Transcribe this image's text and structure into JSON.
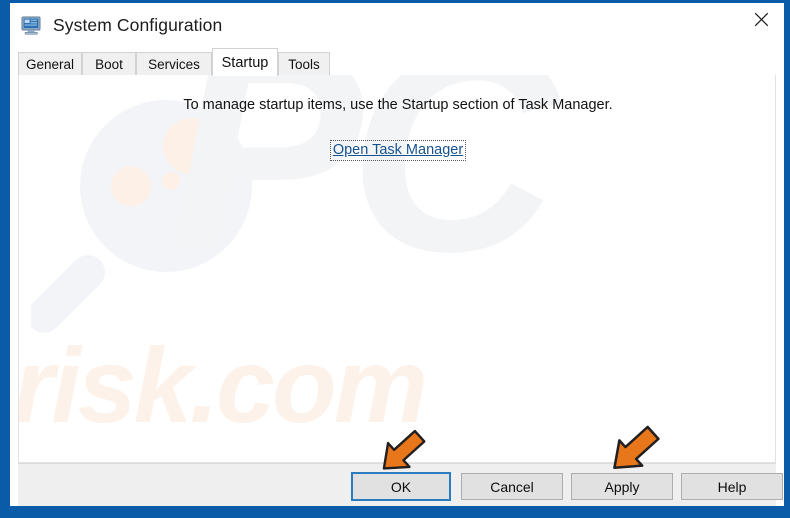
{
  "window": {
    "title": "System Configuration",
    "icon": "system-configuration-monitor-icon",
    "close_label": "✕",
    "border_color": "#0a5ca8"
  },
  "tabs": [
    {
      "label": "General",
      "active": false
    },
    {
      "label": "Boot",
      "active": false
    },
    {
      "label": "Services",
      "active": false
    },
    {
      "label": "Startup",
      "active": true
    },
    {
      "label": "Tools",
      "active": false
    }
  ],
  "content": {
    "message": "To manage startup items, use the Startup section of Task Manager.",
    "link_label": "Open Task Manager",
    "link_color": "#16528f"
  },
  "buttons": [
    {
      "label": "OK",
      "default": true
    },
    {
      "label": "Cancel",
      "default": false
    },
    {
      "label": "Apply",
      "default": false
    },
    {
      "label": "Help",
      "default": false
    }
  ],
  "annotations": {
    "arrow_color": "#e8761a",
    "arrow_outline": "#231f20",
    "arrow_ok_target": "OK",
    "arrow_apply_target": "Apply"
  },
  "watermark": {
    "brand_text": "PC",
    "domain_text": "risk.com",
    "glass_icon": "magnifier-icon",
    "brand_color": "#f3f4f6",
    "domain_color": "#fdf2e9"
  }
}
